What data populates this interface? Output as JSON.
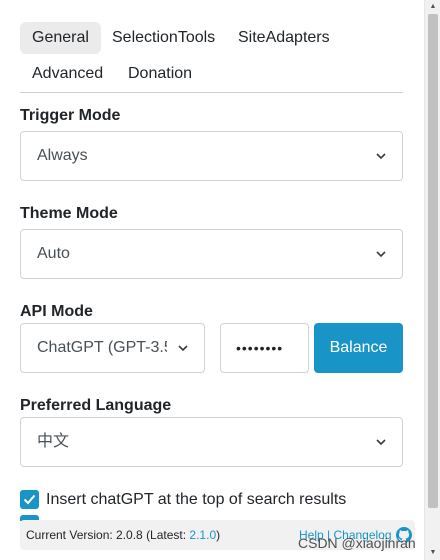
{
  "tabs": [
    {
      "label": "General",
      "active": true
    },
    {
      "label": "SelectionTools"
    },
    {
      "label": "SiteAdapters"
    },
    {
      "label": "Advanced"
    },
    {
      "label": "Donation"
    }
  ],
  "trigger_mode": {
    "title": "Trigger Mode",
    "value": "Always"
  },
  "theme_mode": {
    "title": "Theme Mode",
    "value": "Auto"
  },
  "api_mode": {
    "title": "API Mode",
    "value": "ChatGPT (GPT-3.5",
    "password_value": "••••••••",
    "balance_label": "Balance"
  },
  "preferred_language": {
    "title": "Preferred Language",
    "value": "中文"
  },
  "options": [
    {
      "label": "Insert chatGPT at the top of search results",
      "checked": true
    }
  ],
  "footer": {
    "version_prefix": "Current Version: 2.0.8 (Latest: ",
    "latest_version": "2.1.0",
    "version_suffix": ")",
    "help_link": "Help",
    "separator": " | ",
    "changelog_link": "Changelog"
  },
  "watermark": "CSDN @xiaojinran",
  "colors": {
    "accent": "#1994c6",
    "tab_active_bg": "#ebebeb"
  }
}
